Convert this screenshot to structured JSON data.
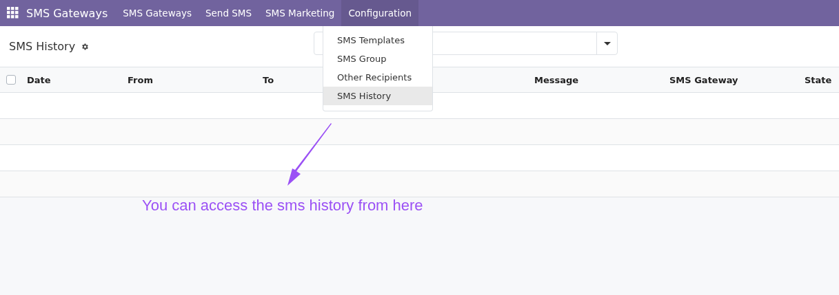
{
  "navbar": {
    "app_name": "SMS Gateways",
    "menus": [
      {
        "label": "SMS Gateways",
        "selected": false
      },
      {
        "label": "Send SMS",
        "selected": false
      },
      {
        "label": "SMS Marketing",
        "selected": false
      },
      {
        "label": "Configuration",
        "selected": true
      }
    ]
  },
  "dropdown": {
    "items": [
      {
        "label": "SMS Templates",
        "selected": false
      },
      {
        "label": "SMS Group",
        "selected": false
      },
      {
        "label": "Other Recipients",
        "selected": false
      },
      {
        "label": "SMS History",
        "selected": true
      }
    ]
  },
  "control_panel": {
    "title": "SMS History"
  },
  "table": {
    "select_all_checked": false,
    "columns": [
      "Date",
      "From",
      "To",
      "Message",
      "SMS Gateway",
      "State"
    ]
  },
  "annotation": "You can access the sms history from here"
}
